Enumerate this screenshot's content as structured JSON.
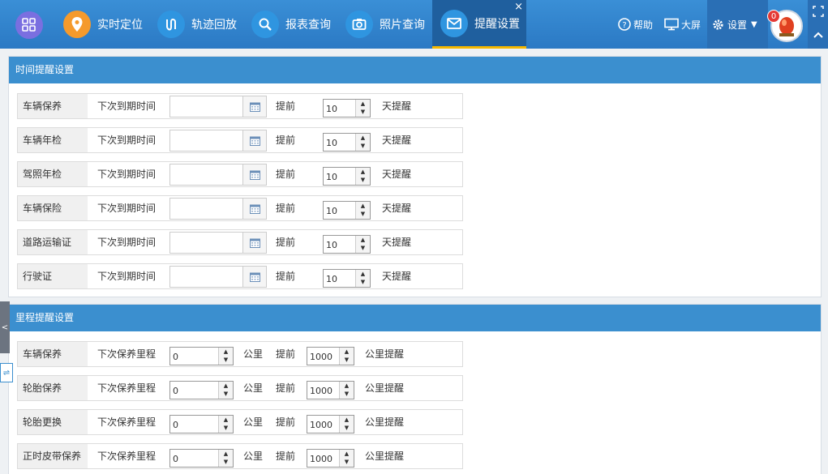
{
  "nav": {
    "items": [
      {
        "label": "实时定位",
        "icon": "location-pin-icon",
        "color": "#f59a2c"
      },
      {
        "label": "轨迹回放",
        "icon": "track-replay-icon",
        "color": "#2f95e0"
      },
      {
        "label": "报表查询",
        "icon": "search-icon",
        "color": "#2f95e0"
      },
      {
        "label": "照片查询",
        "icon": "camera-icon",
        "color": "#2f95e0"
      },
      {
        "label": "提醒设置",
        "icon": "mail-icon",
        "color": "#2f95e0"
      }
    ],
    "close_symbol": "×",
    "help_label": "帮助",
    "screen_label": "大屏",
    "settings_label": "设置",
    "alarm_count": "0"
  },
  "time_panel": {
    "title": "时间提醒设置",
    "due_label": "下次到期时间",
    "advance_label": "提前",
    "days_label": "天提醒",
    "rows": [
      {
        "name": "车辆保养",
        "date": "",
        "days": "10"
      },
      {
        "name": "车辆年检",
        "date": "",
        "days": "10"
      },
      {
        "name": "驾照年检",
        "date": "",
        "days": "10"
      },
      {
        "name": "车辆保险",
        "date": "",
        "days": "10"
      },
      {
        "name": "道路运输证",
        "date": "",
        "days": "10"
      },
      {
        "name": "行驶证",
        "date": "",
        "days": "10"
      }
    ]
  },
  "mileage_panel": {
    "title": "里程提醒设置",
    "next_label": "下次保养里程",
    "km_label": "公里",
    "advance_label": "提前",
    "km_remind_label": "公里提醒",
    "rows": [
      {
        "name": "车辆保养",
        "mileage": "0",
        "advance": "1000"
      },
      {
        "name": "轮胎保养",
        "mileage": "0",
        "advance": "1000"
      },
      {
        "name": "轮胎更换",
        "mileage": "0",
        "advance": "1000"
      },
      {
        "name": "正时皮带保养",
        "mileage": "0",
        "advance": "1000"
      }
    ]
  }
}
